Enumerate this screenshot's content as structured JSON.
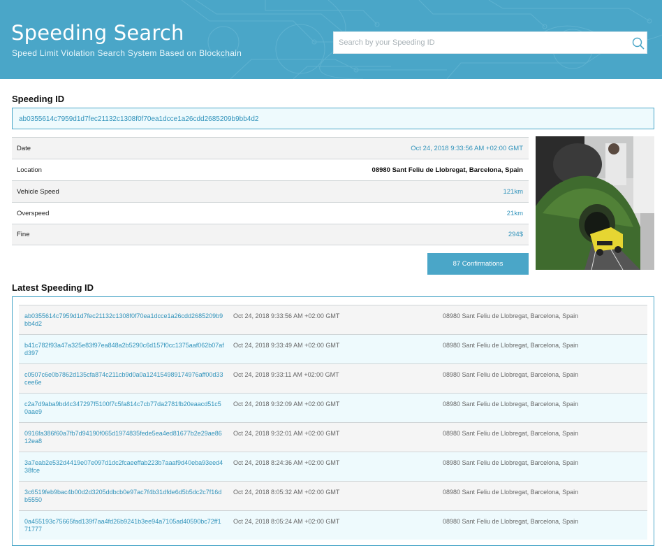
{
  "header": {
    "title": "Speeding Search",
    "subtitle": "Speed Limit Violation Search System Based on Blockchain",
    "search_placeholder": "Search by your Speeding ID",
    "search_value": ""
  },
  "speeding": {
    "heading": "Speeding ID",
    "id": "ab0355614c7959d1d7fec21132c1308f0f70ea1dcce1a26cdd2685209b9bb4d2",
    "details": [
      {
        "label": "Date",
        "value": "Oct 24, 2018 9:33:56 AM +02:00 GMT"
      },
      {
        "label": "Location",
        "value": "08980 Sant Feliu de Llobregat, Barcelona, Spain"
      },
      {
        "label": "Vehicle Speed",
        "value": "121km"
      },
      {
        "label": "Overspeed",
        "value": "21km"
      },
      {
        "label": "Fine",
        "value": "294$"
      }
    ],
    "confirmations_label": "87 Confirmations"
  },
  "latest": {
    "heading": "Latest Speeding ID",
    "rows": [
      {
        "id": "ab0355614c7959d1d7fec21132c1308f0f70ea1dcce1a26cdd2685209b9bb4d2",
        "date": "Oct 24, 2018 9:33:56 AM +02:00 GMT",
        "location": "08980 Sant Feliu de Llobregat, Barcelona, Spain"
      },
      {
        "id": "b41c782f93a47a325e83f97ea848a2b5290c6d157f0cc1375aaf062b07afd397",
        "date": "Oct 24, 2018 9:33:49 AM +02:00 GMT",
        "location": "08980 Sant Feliu de Llobregat, Barcelona, Spain"
      },
      {
        "id": "c0507c6e0b7862d135cfa874c211cb9d0a0a124154989174976aff00d33cee6e",
        "date": "Oct 24, 2018 9:33:11 AM +02:00 GMT",
        "location": "08980 Sant Feliu de Llobregat, Barcelona, Spain"
      },
      {
        "id": "c2a7d9aba9bd4c347297f5100f7c5fa814c7cb77da2781fb20eaacd51c50aae9",
        "date": "Oct 24, 2018 9:32:09 AM +02:00 GMT",
        "location": "08980 Sant Feliu de Llobregat, Barcelona, Spain"
      },
      {
        "id": "0916fa386f60a7fb7d94190f065d1974835fede5ea4ed81677b2e29ae8612ea8",
        "date": "Oct 24, 2018 9:32:01 AM +02:00 GMT",
        "location": "08980 Sant Feliu de Llobregat, Barcelona, Spain"
      },
      {
        "id": "3a7eab2e532d4419e07e097d1dc2fcaeeffab223b7aaaf9d40eba93eed438fce",
        "date": "Oct 24, 2018 8:24:36 AM +02:00 GMT",
        "location": "08980 Sant Feliu de Llobregat, Barcelona, Spain"
      },
      {
        "id": "3c6519feb9bac4b00d2d3205ddbcb0e97ac7f4b31dfde6d5b5dc2c7f16db5550",
        "date": "Oct 24, 2018 8:05:32 AM +02:00 GMT",
        "location": "08980 Sant Feliu de Llobregat, Barcelona, Spain"
      },
      {
        "id": "0a455193c75665fad139f7aa4fd26b9241b3ee94a7105ad40590bc72ff171777",
        "date": "Oct 24, 2018 8:05:24 AM +02:00 GMT",
        "location": "08980 Sant Feliu de Llobregat, Barcelona, Spain"
      }
    ]
  },
  "colors": {
    "accent": "#4aa6c8",
    "link": "#3193bb",
    "row_alt": "#eefafd"
  }
}
